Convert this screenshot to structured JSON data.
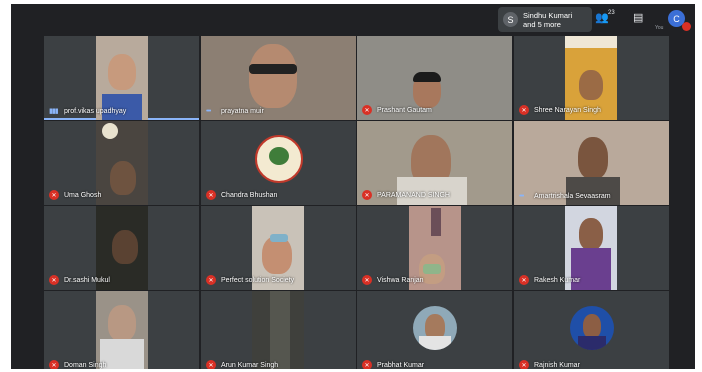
{
  "header": {
    "presenter_initial": "S",
    "presenter_line1": "Sindhu Kumari",
    "presenter_line2": "and 5 more",
    "participants_count": "23",
    "self_initial": "C",
    "self_label": "You"
  },
  "colors": {
    "background": "#202124",
    "tile": "#3c4043",
    "mute": "#d93025",
    "speaking": "#8ab4f8"
  },
  "participants": [
    {
      "name": "prof.vikas upadhyay",
      "status": "speaking"
    },
    {
      "name": "prayatna muir",
      "status": "unmuted"
    },
    {
      "name": "Prashant Gautam",
      "status": "muted"
    },
    {
      "name": "Shree Narayan Singh",
      "status": "muted"
    },
    {
      "name": "Uma Ghosh",
      "status": "muted"
    },
    {
      "name": "Chandra Bhushan",
      "status": "muted"
    },
    {
      "name": "PARAMANAND SINGH",
      "status": "muted"
    },
    {
      "name": "Amartrishala Sevaasram",
      "status": "unmuted"
    },
    {
      "name": "Dr.sashi Mukul",
      "status": "muted"
    },
    {
      "name": "Perfect solution Society",
      "status": "muted"
    },
    {
      "name": "Vishwa Ranjan",
      "status": "muted"
    },
    {
      "name": "Rakesh Kumar",
      "status": "muted"
    },
    {
      "name": "Doman Singh",
      "status": "muted"
    },
    {
      "name": "Arun Kumar Singh",
      "status": "muted"
    },
    {
      "name": "Prabhat Kumar",
      "status": "muted"
    },
    {
      "name": "Rajnish Kumar",
      "status": "muted"
    }
  ]
}
